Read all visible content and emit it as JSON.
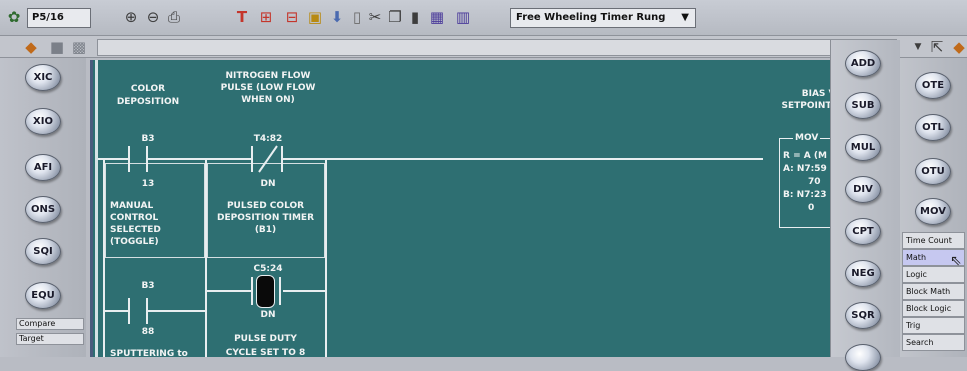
{
  "toolbar": {
    "file_name": "P5/16",
    "rung_select": "Free Wheeling Timer Rung",
    "icons": [
      "module-icon",
      "zoom-in-icon",
      "zoom-out-icon",
      "print-icon",
      "branch-icon",
      "rung-insert-icon",
      "rung-delete-icon",
      "verify-icon",
      "download-icon",
      "trash-icon",
      "cut-icon",
      "copy-icon",
      "paste-icon",
      "grid-icon",
      "columns-icon"
    ]
  },
  "left_palette": {
    "buttons": [
      "XIC",
      "XIO",
      "AFI",
      "ONS",
      "SQI",
      "EQU"
    ],
    "tabs": [
      "Compare",
      "Target"
    ]
  },
  "math_palette": {
    "buttons": [
      "ADD",
      "SUB",
      "MUL",
      "DIV",
      "CPT",
      "NEG",
      "SQR"
    ]
  },
  "right_palette": {
    "buttons": [
      "OTE",
      "OTL",
      "OTU",
      "MOV"
    ],
    "menu": [
      "Time Count",
      "Math",
      "Logic",
      "Block Math",
      "Block Logic",
      "Trig",
      "Search"
    ],
    "active_menu": "Math"
  },
  "ladder": {
    "c1_desc": [
      "COLOR",
      "DEPOSITION"
    ],
    "c1_addr": "B3",
    "c1_bit": "13",
    "c1_desc2": [
      "MANUAL",
      "CONTROL",
      "SELECTED",
      "(TOGGLE)"
    ],
    "c2_desc": [
      "NITROGEN FLOW",
      "PULSE (LOW FLOW",
      "WHEN ON)"
    ],
    "c2_addr": "T4:82",
    "c2_bit": "DN",
    "c2_desc2": [
      "PULSED COLOR",
      "DEPOSITION TIMER",
      "(B1)"
    ],
    "b1_addr": "B3",
    "b1_bit": "88",
    "b1_desc": "SPUTTERING to",
    "b2_addr": "C5:24",
    "b2_bit": "DN",
    "b2_desc": [
      "PULSE DUTY",
      "CYCLE SET TO 8"
    ],
    "mov_desc": [
      "BIAS VO",
      "SETPOINT fr"
    ],
    "mov_title": "MOV",
    "mov_lines": [
      "R = A (M",
      "A:  N7:59",
      "70",
      "B:  N7:23",
      "0"
    ]
  },
  "colors": {
    "canvas": "#2e6f72",
    "toolbar": "#c2c5cc",
    "text_on_canvas": "#f2f4f4"
  }
}
